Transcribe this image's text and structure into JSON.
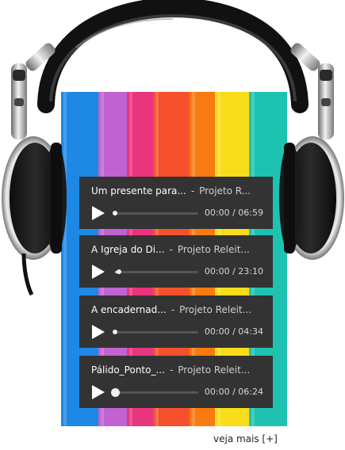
{
  "colors": {
    "book_spines": [
      "#1e88e5",
      "#c062d1",
      "#e8357d",
      "#f4512c",
      "#f97a10",
      "#f9dc1a",
      "#1dc3b0"
    ],
    "player_bg": "#333333"
  },
  "players": [
    {
      "title": "Um presente para...",
      "artist": "Projeto R...",
      "sep": "-",
      "current": "00:00",
      "duration": "06:59",
      "time": "00:00 / 06:59",
      "progress": 0.0,
      "icon": "play-icon"
    },
    {
      "title": "A Igreja do Di...",
      "artist": "Projeto Releit...",
      "sep": "-",
      "current": "00:00",
      "duration": "23:10",
      "time": "00:00 / 23:10",
      "progress": 0.05,
      "icon": "play-icon"
    },
    {
      "title": "A encadernad...",
      "artist": "Projeto Releit...",
      "sep": "-",
      "current": "00:00",
      "duration": "04:34",
      "time": "00:00 / 04:34",
      "progress": 0.0,
      "icon": "play-icon"
    },
    {
      "title": "Pálido_Ponto_...",
      "artist": "Projeto Releit...",
      "sep": "-",
      "current": "00:00",
      "duration": "06:24",
      "time": "00:00 / 06:24",
      "progress": 0.0,
      "icon": "play-icon"
    }
  ],
  "more_link": "veja mais [+]"
}
